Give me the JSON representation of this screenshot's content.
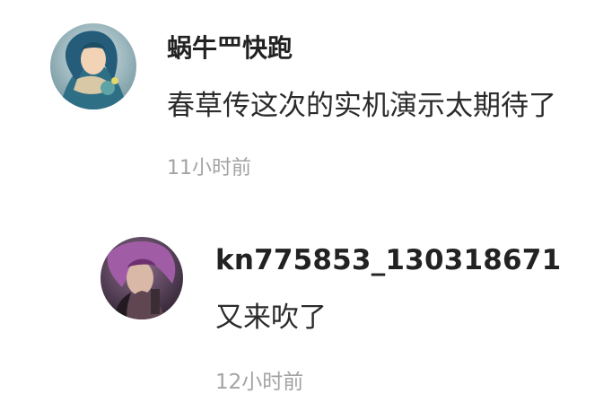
{
  "comments": [
    {
      "avatar_icon": "user-avatar-icon",
      "username": "蜗牛罒快跑",
      "content": "春草传这次的实机演示太期待了",
      "time": "11小时前"
    }
  ],
  "replies": [
    {
      "avatar_icon": "user-avatar-icon",
      "username": "kn775853_130318671",
      "content": "又来吹了",
      "time": "12小时前"
    }
  ],
  "colors": {
    "username": "#222222",
    "content": "#2b2b2b",
    "timestamp": "#a3a3a3",
    "background": "#ffffff"
  }
}
